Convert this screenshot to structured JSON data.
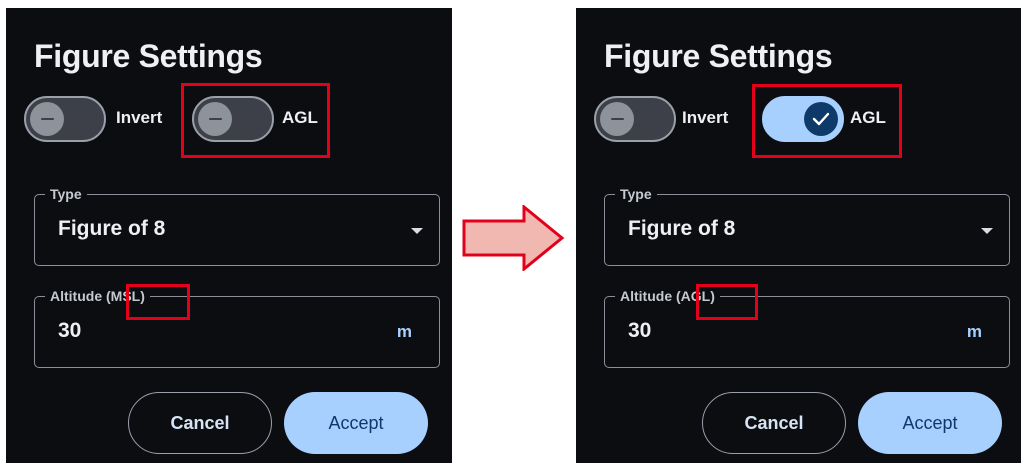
{
  "panels": [
    {
      "title": "Figure Settings",
      "toggles": [
        {
          "label": "Invert",
          "state": "off"
        },
        {
          "label": "AGL",
          "state": "off"
        }
      ],
      "type_field": {
        "legend": "Type",
        "value": "Figure of 8"
      },
      "altitude_field": {
        "legend_prefix": "Altitude",
        "legend_suffix": "(MSL)",
        "value": "30",
        "unit": "m"
      },
      "buttons": {
        "cancel": "Cancel",
        "accept": "Accept"
      }
    },
    {
      "title": "Figure Settings",
      "toggles": [
        {
          "label": "Invert",
          "state": "off"
        },
        {
          "label": "AGL",
          "state": "on"
        }
      ],
      "type_field": {
        "legend": "Type",
        "value": "Figure of 8"
      },
      "altitude_field": {
        "legend_prefix": "Altitude",
        "legend_suffix": "(AGL)",
        "value": "30",
        "unit": "m"
      },
      "buttons": {
        "cancel": "Cancel",
        "accept": "Accept"
      }
    }
  ],
  "colors": {
    "panel_bg": "#0c0d10",
    "accent": "#a7d0ff",
    "highlight": "#e3001b",
    "arrow_fill": "#f0b8b0"
  },
  "icons": [
    "minus-icon",
    "check-icon",
    "chevron-down-icon",
    "right-arrow-icon"
  ]
}
